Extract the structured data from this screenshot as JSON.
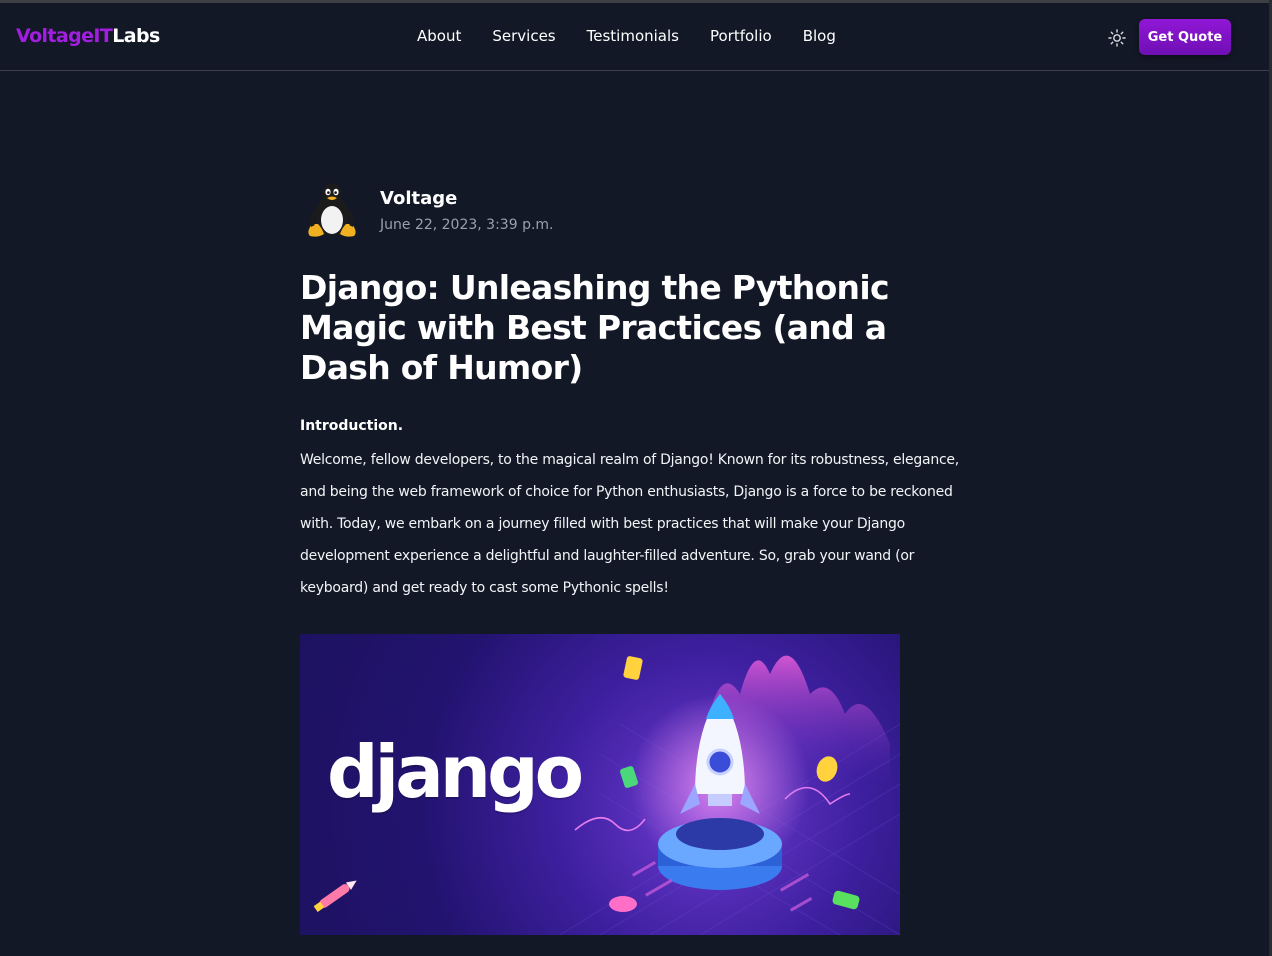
{
  "brand": {
    "name_part1": "VoltageIT",
    "name_part2": "Labs",
    "accent_color": "#a21ee0"
  },
  "nav": {
    "items": [
      "About",
      "Services",
      "Testimonials",
      "Portfolio",
      "Blog"
    ],
    "theme_toggle_icon": "sun-icon",
    "cta_label": "Get Quote"
  },
  "post": {
    "author": "Voltage",
    "author_avatar_icon": "penguin-avatar",
    "date": "June 22, 2023, 3:39 p.m.",
    "title": "Django: Unleashing the Pythonic Magic with Best Practices (and a Dash of Humor)",
    "intro_heading": "Introduction.",
    "intro_body": "Welcome, fellow developers, to the magical realm of Django! Known for its robustness, elegance, and being the web framework of choice for Python enthusiasts, Django is a force to be reckoned with. Today, we embark on a journey filled with best practices that will make your Django development experience a delightful and laughter-filled adventure. So, grab your wand (or keyboard) and get ready to cast some Pythonic spells!",
    "hero_image": {
      "wordmark": "django",
      "icon": "rocket-illustration"
    }
  },
  "colors": {
    "background": "#121826",
    "button": "#8a16d2",
    "muted_text": "#9aa1ad"
  }
}
